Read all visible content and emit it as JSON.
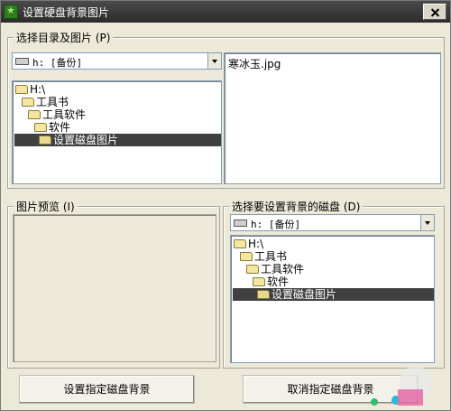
{
  "window": {
    "title": "设置硬盘背景图片"
  },
  "select_group": {
    "legend": "选择目录及图片 (P)",
    "drive_combo": "h: [备份]",
    "folders": [
      "H:\\",
      "工具书",
      "工具软件",
      "软件",
      "设置磁盘图片"
    ],
    "selected_index": 4,
    "files": [
      "寒冰玉.jpg"
    ]
  },
  "preview_group": {
    "legend": "图片预览 (I)"
  },
  "target_group": {
    "legend": "选择要设置背景的磁盘 (D)",
    "drive_combo": "h: [备份]",
    "folders": [
      "H:\\",
      "工具书",
      "工具软件",
      "软件",
      "设置磁盘图片"
    ],
    "selected_index": 4
  },
  "buttons": {
    "set_label": "设置指定磁盘背景",
    "cancel_label": "取消指定磁盘背景"
  },
  "icons": {
    "app": "app-icon",
    "close": "close-icon",
    "drive": "drive-icon",
    "folder": "folder-icon",
    "dropdown": "chevron-down-icon"
  }
}
